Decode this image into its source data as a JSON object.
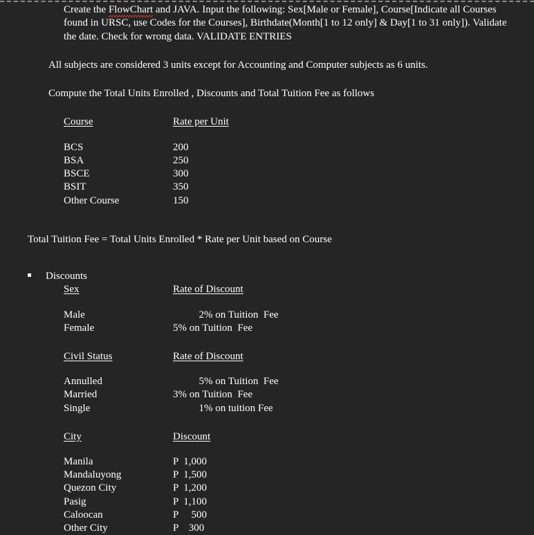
{
  "document": {
    "intro": {
      "before_misspelled": "Create the ",
      "misspelled_word": "FlowChart",
      "after_misspelled": " and JAVA. Input the following:  Sex[Male  or Female],  Course[Indicate all Courses found in  URSC, use Codes for the Courses],  Birthdate(Month[1 to 12 only] & Day[1 to 31 only]).   Validate the date. Check for wrong data. VALIDATE ENTRIES"
    },
    "units_note": "All subjects are considered 3 units except for Accounting and Computer subjects as 6 units.",
    "compute_note": "Compute the Total Units Enrolled , Discounts and Total Tuition Fee as follows",
    "course_table": {
      "headers": [
        "Course",
        "Rate per Unit"
      ],
      "rows": [
        {
          "name": "BCS",
          "value": "200"
        },
        {
          "name": "BSA",
          "value": "250"
        },
        {
          "name": "BSCE",
          "value": "300"
        },
        {
          "name": "BSIT",
          "value": "350"
        },
        {
          "name": "Other Course",
          "value": "150"
        }
      ]
    },
    "total_formula": "Total Tuition Fee = Total Units Enrolled * Rate per Unit based on Course",
    "discounts_heading": "Discounts",
    "sex_table": {
      "headers": [
        "Sex",
        "Rate of Discount"
      ],
      "rows": [
        {
          "name": "Male",
          "value": "          2% on Tuition  Fee"
        },
        {
          "name": "Female",
          "value": "5% on Tuition  Fee"
        }
      ]
    },
    "civil_status_table": {
      "headers": [
        "Civil Status",
        "Rate of Discount"
      ],
      "rows": [
        {
          "name": "Annulled",
          "value": "          5% on Tuition  Fee"
        },
        {
          "name": "Married",
          "value": "3% on Tuition  Fee"
        },
        {
          "name": "Single",
          "value": "          1% on tuition Fee"
        }
      ]
    },
    "city_table": {
      "headers": [
        "City",
        "Discount"
      ],
      "rows": [
        {
          "name": "Manila",
          "value": "P  1,000"
        },
        {
          "name": "Mandaluyong",
          "value": "P  1,500"
        },
        {
          "name": "Quezon City",
          "value": "P  1,200"
        },
        {
          "name": "Pasig",
          "value": "P  1,100"
        },
        {
          "name": "Caloocan",
          "value": "P     500"
        },
        {
          "name": "Other City",
          "value": "P    300"
        }
      ]
    }
  },
  "colors": {
    "background": "#252525",
    "text": "#ffffff",
    "spellcheck_underline": "#d93b2b",
    "rule": "#8a8a8a"
  }
}
